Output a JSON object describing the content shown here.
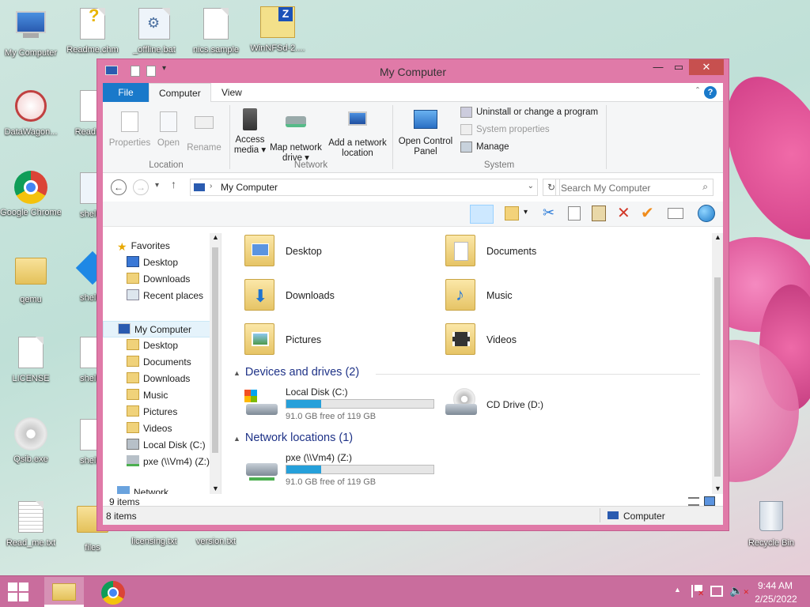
{
  "desktop": {
    "icons": [
      {
        "label": "My Computer"
      },
      {
        "label": "Readme.chm"
      },
      {
        "label": "_offline.bat"
      },
      {
        "label": "nics.sample"
      },
      {
        "label": "WinNFSd-2...."
      },
      {
        "label": "DataWagon..."
      },
      {
        "label": "Readm..."
      },
      {
        "label": "Google Chrome"
      },
      {
        "label": "shell..."
      },
      {
        "label": "qemu"
      },
      {
        "label": "shell..."
      },
      {
        "label": "LICENSE"
      },
      {
        "label": "shell..."
      },
      {
        "label": "Qsib.exe"
      },
      {
        "label": "shell..."
      },
      {
        "label": "Read_me.txt"
      },
      {
        "label": "files"
      },
      {
        "label": "licensing.txt"
      },
      {
        "label": "version.txt"
      },
      {
        "label": "Recycle Bin"
      }
    ]
  },
  "window": {
    "title": "My Computer",
    "tabs": [
      "File",
      "Computer",
      "View"
    ],
    "ribbon": {
      "location": {
        "properties": "Properties",
        "open": "Open",
        "rename": "Rename",
        "group": "Location"
      },
      "network": {
        "access_media": "Access media ▾",
        "map_drive": "Map network drive ▾",
        "add_location": "Add a network location",
        "group": "Network"
      },
      "system": {
        "control_panel": "Open Control Panel",
        "uninstall": "Uninstall or change a program",
        "sys_props": "System properties",
        "manage": "Manage",
        "group": "System"
      }
    },
    "address": {
      "path": "My Computer",
      "search_placeholder": "Search My Computer"
    },
    "nav": {
      "favorites": "Favorites",
      "fav_items": [
        "Desktop",
        "Downloads",
        "Recent places"
      ],
      "computer": "My Computer",
      "comp_items": [
        "Desktop",
        "Documents",
        "Downloads",
        "Music",
        "Pictures",
        "Videos",
        "Local Disk (C:)",
        "pxe (\\\\Vm4) (Z:)"
      ],
      "network": "Network"
    },
    "folders": [
      "Desktop",
      "Documents",
      "Downloads",
      "Music",
      "Pictures",
      "Videos"
    ],
    "devices_header": "Devices and drives (2)",
    "local_disk": {
      "name": "Local Disk (C:)",
      "free": "91.0 GB free of 119 GB",
      "used_fraction": 0.235
    },
    "cd_drive": {
      "name": "CD Drive (D:)"
    },
    "network_header": "Network locations (1)",
    "pxe": {
      "name": "pxe (\\\\Vm4) (Z:)",
      "free": "91.0 GB free of 119 GB",
      "used_fraction": 0.235
    },
    "inner_count": "9 items",
    "status_count": "8 items",
    "status_location": "Computer"
  },
  "taskbar": {
    "time": "9:44 AM",
    "date": "2/25/2022"
  }
}
